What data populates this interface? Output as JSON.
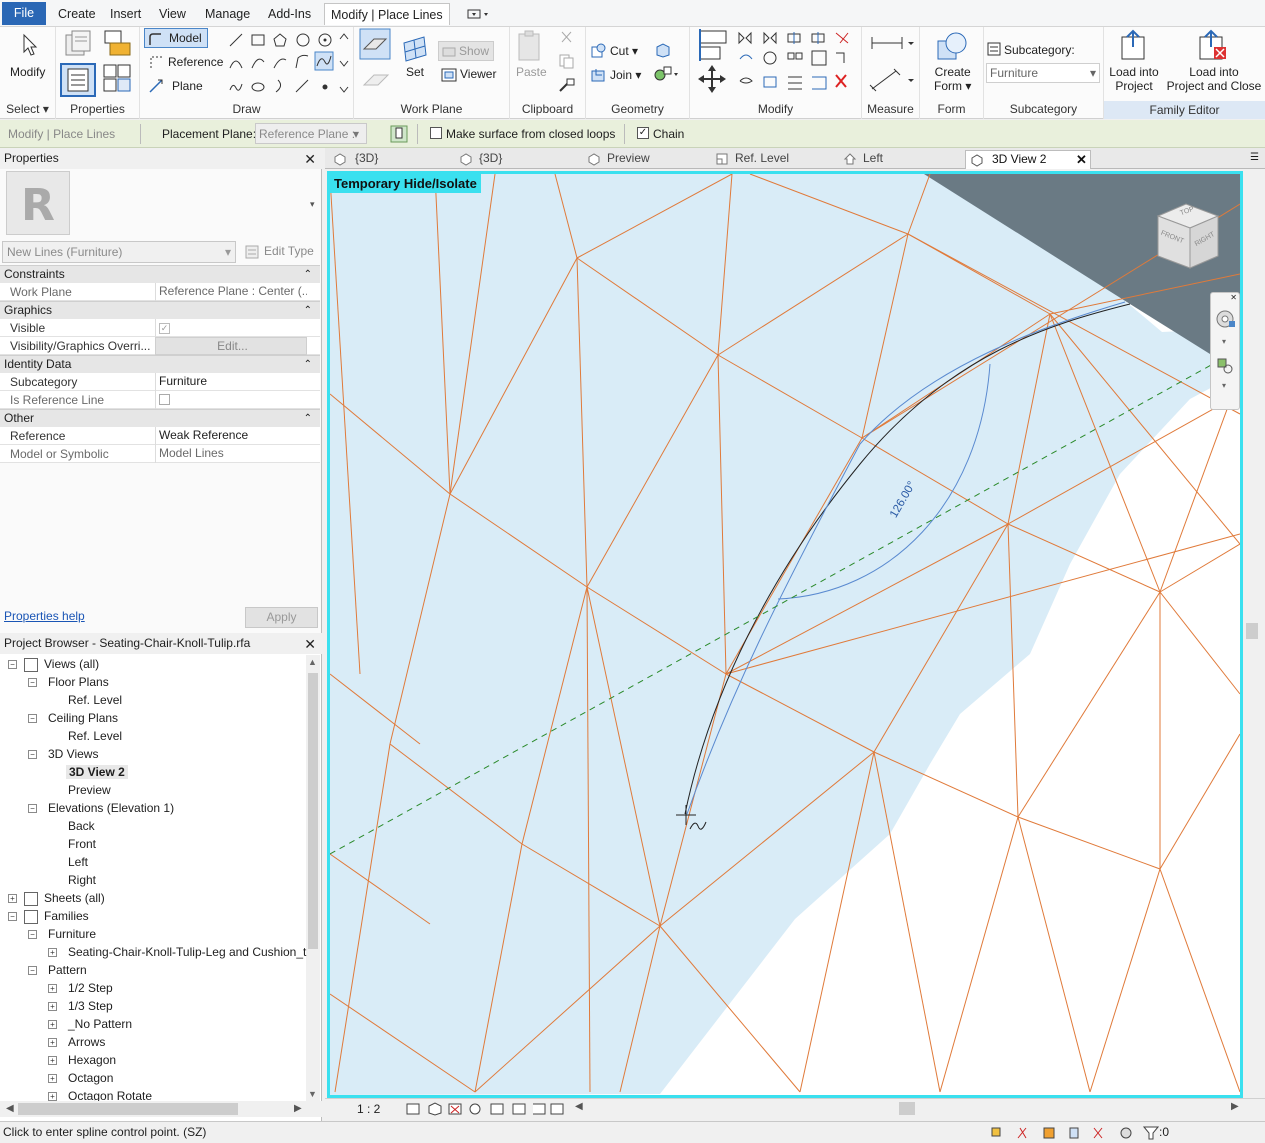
{
  "menu": {
    "tabs": [
      "File",
      "Create",
      "Insert",
      "View",
      "Manage",
      "Add-Ins",
      "Modify | Place Lines"
    ]
  },
  "ribbon": {
    "select": {
      "modify_label": "Modify",
      "panel": "Select"
    },
    "properties": {
      "panel": "Properties"
    },
    "draw": {
      "panel": "Draw",
      "model_label": "Model",
      "reference_label": "Reference",
      "plane_label": "Plane"
    },
    "work_plane": {
      "panel": "Work Plane",
      "set_label": "Set",
      "show_label": "Show",
      "viewer_label": "Viewer"
    },
    "clipboard": {
      "panel": "Clipboard",
      "paste_label": "Paste"
    },
    "geometry": {
      "panel": "Geometry",
      "cut_label": "Cut",
      "join_label": "Join"
    },
    "modify": {
      "panel": "Modify"
    },
    "measure": {
      "panel": "Measure"
    },
    "form": {
      "panel": "Form",
      "create_form_line1": "Create",
      "create_form_line2": "Form"
    },
    "subcategory": {
      "panel": "Subcategory",
      "label": "Subcategory:",
      "value": "Furniture"
    },
    "family_editor": {
      "panel": "Family Editor",
      "load_project_line1": "Load into",
      "load_project_line2": "Project",
      "load_close_line1": "Load into",
      "load_close_line2": "Project and Close"
    }
  },
  "options_bar": {
    "context": "Modify | Place Lines",
    "placement_plane_label": "Placement Plane:",
    "placement_plane_value": "Reference Plane :",
    "make_surface_label": "Make surface from closed loops",
    "chain_label": "Chain",
    "make_surface_checked": false,
    "chain_checked": true
  },
  "properties": {
    "title": "Properties",
    "type_selector": "New Lines (Furniture)",
    "edit_type_label": "Edit Type",
    "sections": {
      "constraints": "Constraints",
      "graphics": "Graphics",
      "identity": "Identity Data",
      "other": "Other"
    },
    "rows": {
      "work_plane": {
        "name": "Work Plane",
        "value": "Reference Plane : Center (..."
      },
      "visible": {
        "name": "Visible",
        "value": true
      },
      "vis_graphics": {
        "name": "Visibility/Graphics Overri...",
        "value": "Edit..."
      },
      "subcategory": {
        "name": "Subcategory",
        "value": "Furniture"
      },
      "is_reference_line": {
        "name": "Is Reference Line",
        "value": false
      },
      "reference": {
        "name": "Reference",
        "value": "Weak Reference"
      },
      "model_or_symbolic": {
        "name": "Model or Symbolic",
        "value": "Model Lines"
      }
    },
    "help_link": "Properties help",
    "apply_label": "Apply"
  },
  "project_browser": {
    "title": "Project Browser - Seating-Chair-Knoll-Tulip.rfa",
    "nodes": [
      "Views (all)",
      "Floor Plans",
      "Ref. Level",
      "Ceiling Plans",
      "Ref. Level",
      "3D Views",
      "3D View 2",
      "Preview",
      "Elevations (Elevation 1)",
      "Back",
      "Front",
      "Left",
      "Right",
      "Sheets (all)",
      "Families",
      "Furniture",
      "Seating-Chair-Knoll-Tulip-Leg and Cushion_t",
      "Pattern",
      "1/2 Step",
      "1/3 Step",
      "_No Pattern",
      "Arrows",
      "Hexagon",
      "Octagon",
      "Octagon Rotate"
    ]
  },
  "view_tabs": [
    "{3D}",
    "{3D}",
    "Preview",
    "Ref. Level",
    "Left",
    "3D View 2"
  ],
  "canvas": {
    "banner": "Temporary Hide/Isolate",
    "angle_label": "126.00°",
    "viewcube_top": "TOP",
    "viewcube_front": "FRONT",
    "viewcube_right": "RIGHT"
  },
  "view_control_bar": {
    "scale": "1 : 2"
  },
  "status_bar": {
    "message": "Click to enter spline control point.  (SZ)",
    "filter_count": ":0"
  },
  "colors": {
    "file_tab": "#2a67b5",
    "highlight_border": "#3ae0ef",
    "mesh_line": "#e07a3a",
    "surface_fill": "#d9ecf7",
    "options_bar_bg": "#e9f0dc",
    "dark_region": "#6a7a84",
    "reference_dash": "#2a8a2a"
  }
}
